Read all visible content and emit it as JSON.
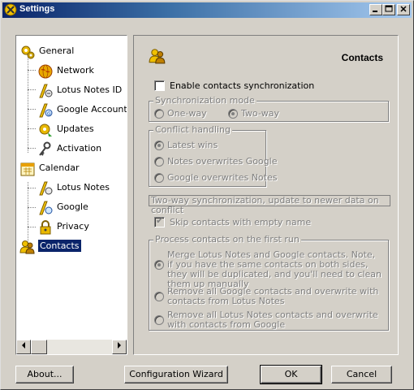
{
  "window": {
    "title": "Settings"
  },
  "tree": {
    "items": [
      {
        "label": "General",
        "icon": "gear-icon"
      },
      {
        "label": "Network",
        "icon": "globe-icon"
      },
      {
        "label": "Lotus Notes ID",
        "icon": "id-icon"
      },
      {
        "label": "Google Account",
        "icon": "google-account-icon"
      },
      {
        "label": "Updates",
        "icon": "updates-icon"
      },
      {
        "label": "Activation",
        "icon": "key-icon"
      },
      {
        "label": "Calendar",
        "icon": "calendar-icon"
      },
      {
        "label": "Lotus Notes",
        "icon": "lotus-notes-icon"
      },
      {
        "label": "Google",
        "icon": "google-icon"
      },
      {
        "label": "Privacy",
        "icon": "lock-icon"
      },
      {
        "label": "Contacts",
        "icon": "contacts-icon"
      }
    ],
    "selected": "Contacts"
  },
  "panel": {
    "title": "Contacts",
    "enable_label": "Enable contacts synchronization",
    "enable_checked": false,
    "sync_mode": {
      "legend": "Synchronization mode",
      "options": [
        "One-way",
        "Two-way"
      ],
      "selected": "Two-way"
    },
    "conflict": {
      "legend": "Conflict handling",
      "options": [
        "Latest wins",
        "Notes overwrites Google",
        "Google overwrites Notes"
      ],
      "selected": "Latest wins"
    },
    "summary": "Two-way synchronization, update to newer data on conflict",
    "skip_label": "Skip contacts with empty name",
    "skip_checked": true,
    "first_run": {
      "legend": "Process contacts on the first run",
      "options": [
        "Merge Lotus Notes and Google contacts. Note, if you have the same contacts on both sides, they will be duplicated, and you'll need to clean them up manually",
        "Remove all Google contacts and overwrite with contacts from Lotus Notes",
        "Remove all Lotus Notes contacts and overwrite with contacts from Google"
      ],
      "selected": 0
    }
  },
  "buttons": {
    "about": "About...",
    "wizard": "Configuration Wizard",
    "ok": "OK",
    "cancel": "Cancel"
  },
  "colors": {
    "title_gradient_start": "#0a246a",
    "title_gradient_end": "#a6caf0",
    "dialog_bg": "#d4d0c8",
    "selection": "#0a246a"
  }
}
